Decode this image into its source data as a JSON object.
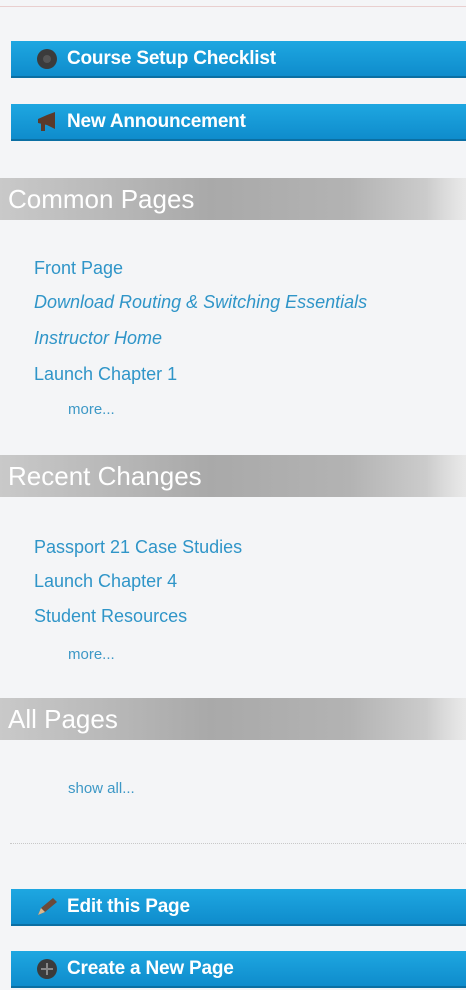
{
  "actions": {
    "checklist": "Course Setup Checklist",
    "announcement": "New Announcement",
    "edit": "Edit this Page",
    "create": "Create a New Page"
  },
  "sections": {
    "common": {
      "title": "Common Pages",
      "links": [
        "Front Page",
        "Download Routing & Switching Essentials",
        "Instructor Home",
        "Launch Chapter 1"
      ],
      "more": "more..."
    },
    "recent": {
      "title": "Recent Changes",
      "links": [
        "Passport 21 Case Studies",
        "Launch Chapter 4",
        "Student Resources"
      ],
      "more": "more..."
    },
    "all": {
      "title": "All Pages",
      "show_all": "show all..."
    }
  },
  "colors": {
    "button": "#1a9fdc",
    "link": "#2f95c8",
    "header_gray": "#ababab"
  },
  "icons": {
    "checklist": "circle-icon",
    "announcement": "megaphone-icon",
    "edit": "pencil-icon",
    "create": "plus-circle-icon"
  }
}
